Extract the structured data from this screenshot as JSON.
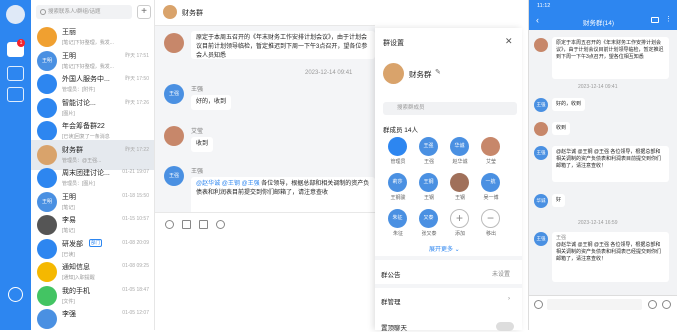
{
  "colors": {
    "accent": "#2d86f0",
    "rail": "#2d86f0",
    "badge": "#f5222d",
    "selected_row": "#e5e9ee"
  },
  "rail": {
    "badge": "1"
  },
  "conv": {
    "search_placeholder": "搜索联系人/群组/话题",
    "add_label": "+",
    "items": [
      {
        "name": "王丽",
        "snippet": "[笔记]下好整理，我发...",
        "time": "",
        "avatar": "",
        "color": "#f0a030"
      },
      {
        "name": "王明",
        "snippet": "[笔记]下好整理，我发...",
        "time": "昨天 17:51",
        "avatar": "王明",
        "color": "#4a90e2"
      },
      {
        "name": "外国人服务中...",
        "snippet": "管理员：[附件]",
        "time": "昨天 17:50",
        "avatar": "",
        "color": "#2d86f0"
      },
      {
        "name": "智能讨论...",
        "snippet": "[图片]",
        "time": "昨天 17:26",
        "avatar": "",
        "color": "#2d86f0"
      },
      {
        "name": "年会筹备群22",
        "snippet": "[已读]回复了一条消息",
        "time": "",
        "avatar": "",
        "color": "#2d86f0"
      },
      {
        "name": "财务群",
        "snippet": "管理员：@王强...",
        "time": "昨天 17:22",
        "avatar": "",
        "color": "#d9a36b"
      },
      {
        "name": "周末团建讨论...",
        "snippet": "管理员：[图片]",
        "time": "01-21 19:07",
        "avatar": "",
        "color": "#2d86f0"
      },
      {
        "name": "王明",
        "snippet": "[笔记]",
        "time": "01-18 15:50",
        "avatar": "王明",
        "color": "#4a90e2"
      },
      {
        "name": "李易",
        "snippet": "[笔记]",
        "time": "01-15 10:57",
        "avatar": "",
        "color": "#555"
      },
      {
        "name": "研发部",
        "tag": "部门",
        "snippet": "[已读]",
        "time": "01-08 20:09",
        "avatar": "",
        "color": "#2d86f0"
      },
      {
        "name": "通知信息",
        "snippet": "[通知]入职提醒",
        "time": "01-08 09:25",
        "avatar": "",
        "color": "#f5b800"
      },
      {
        "name": "我的手机",
        "snippet": "[文件]",
        "time": "01-05 18:47",
        "avatar": "",
        "color": "#43c463"
      },
      {
        "name": "李强",
        "snippet": "",
        "time": "01-05 12:07",
        "avatar": "",
        "color": "#4a90e2"
      }
    ]
  },
  "chat": {
    "title": "财务群",
    "notice": "原定于本周五召开的《年末财务工作安排计划会议》，由于计划会议目前计划领导临检，暂定推迟到下周一下午3点召开，望各位参会人员知悉",
    "timestamp": "2023-12-14 09:41",
    "messages": [
      {
        "name": "王强",
        "text": "好的，收到",
        "avatar": "王强",
        "color": "#4a90e2"
      },
      {
        "name": "艾莹",
        "text": "收到",
        "avatar": "",
        "color": "#c7876a"
      },
      {
        "name": "王强",
        "mentions": [
          "@赵华诚",
          "@王钢",
          "@王强"
        ],
        "text": "各位领导，根据总部和相关调制的资产负债表和利润表目前提交到你们邮箱了，请注意查收",
        "avatar": "王强",
        "color": "#4a90e2"
      }
    ]
  },
  "panel": {
    "title": "群设置",
    "group_name": "财务群",
    "search_placeholder": "搜索群成员",
    "members_label": "群成员 14人",
    "members": [
      {
        "name": "管理员",
        "avatar": "",
        "color": "#2d86f0"
      },
      {
        "name": "王强",
        "avatar": "王强",
        "color": "#4a90e2"
      },
      {
        "name": "赵华诚",
        "avatar": "华诚",
        "color": "#4a90e2"
      },
      {
        "name": "艾莹",
        "avatar": "",
        "color": "#c7876a"
      },
      {
        "name": "王钢骏",
        "avatar": "莉莎",
        "color": "#4a90e2"
      },
      {
        "name": "王钢",
        "avatar": "王钢",
        "color": "#4a90e2"
      },
      {
        "name": "王钢",
        "avatar": "",
        "color": "#a0705a"
      },
      {
        "name": "吴一博",
        "avatar": "一航",
        "color": "#4a90e2"
      },
      {
        "name": "朱征",
        "avatar": "朱征",
        "color": "#4a90e2"
      },
      {
        "name": "张又泰",
        "avatar": "又泰",
        "color": "#4a90e2"
      },
      {
        "name": "添加",
        "avatar": "+",
        "color": "#fff"
      },
      {
        "name": "移出",
        "avatar": "−",
        "color": "#fff"
      }
    ],
    "expand_label": "展开更多 ⌄",
    "announcement_label": "群公告",
    "announcement_value": "未设置",
    "manage_label": "群管理",
    "pin_label": "置顶聊天"
  },
  "phone": {
    "time": "11:12",
    "title": "财务群(14)",
    "notice": "原定于本周五召开的《年末财务工作安排计划会议》，由于计划会议目前计划领导临检，暂定推迟到下周一下午3点召开，望各位相互知悉",
    "ts1": "2023-12-14 09:41",
    "ts2": "2023-12-14 16:59",
    "msgs": [
      {
        "text": "好的，收到",
        "avatar": "王强",
        "color": "#4a90e2"
      },
      {
        "text": "收到",
        "avatar": "",
        "color": "#c7876a"
      },
      {
        "text": "@赵华诚 @王钢 @王强 各位领导，根据总部和相关调制的资产负债表和利润表目前提交到你们邮箱了，请注意查收！",
        "avatar": "王强",
        "color": "#4a90e2"
      },
      {
        "text": "好",
        "avatar": "华诚",
        "color": "#4a90e2"
      },
      {
        "text": "@赵华诚 @王钢 @王强 各位领导，根据总部和相关调制的资产负债表和利润表已经提交到你们邮箱了，请注意查收！",
        "avatar": "王强",
        "color": "#4a90e2",
        "quoted": "王强"
      }
    ]
  }
}
